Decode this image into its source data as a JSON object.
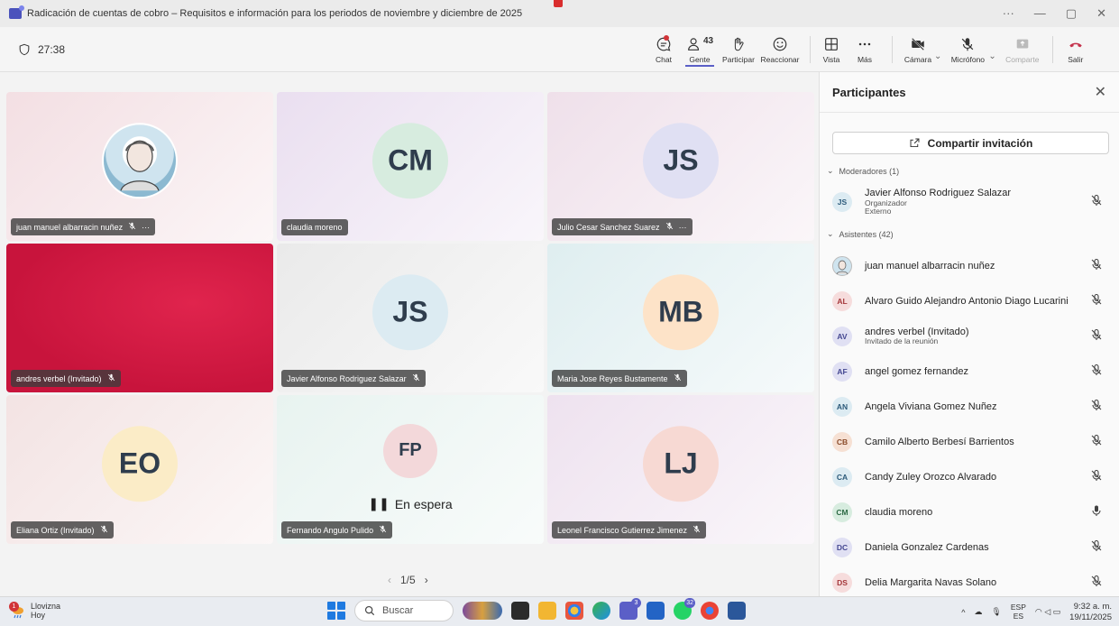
{
  "window": {
    "title": "Radicación de cuentas de cobro – Requisitos e información para los periodos de noviembre y diciembre de 2025",
    "controls": [
      "···",
      "—",
      "▢",
      "✕"
    ]
  },
  "toolbar": {
    "timer": "27:38",
    "people_count": "43",
    "buttons": {
      "chat": "Chat",
      "people": "Gente",
      "raise": "Participar",
      "react": "Reaccionar",
      "view": "Vista",
      "more": "Más",
      "camera": "Cámara",
      "mic": "Micrófono",
      "share": "Comparte",
      "leave": "Salir"
    }
  },
  "tiles": [
    {
      "name": "juan manuel albarracin nuñez",
      "initials": "",
      "has_photo": true,
      "bg": "#f3dfe3",
      "more": "···"
    },
    {
      "name": "claudia moreno",
      "initials": "CM",
      "bg": "#eadff0",
      "avatar_bg": "#d7ecdf"
    },
    {
      "name": "Julio Cesar Sanchez Suarez",
      "initials": "JS",
      "bg": "#efe0ea",
      "avatar_bg": "#e0e0f3",
      "more": "···"
    },
    {
      "name": "andres verbel (Invitado)",
      "initials": "",
      "bg": "#c8143c"
    },
    {
      "name": "Javier Alfonso Rodriguez Salazar",
      "initials": "JS",
      "bg": "#eaeaea",
      "avatar_bg": "#dcebf2"
    },
    {
      "name": "Maria Jose Reyes Bustamente",
      "initials": "MB",
      "bg": "#dfeef0",
      "avatar_bg": "#fde3c8"
    },
    {
      "name": "Eliana Ortiz (Invitado)",
      "initials": "EO",
      "bg": "#f3e3e3",
      "avatar_bg": "#fbecc7"
    },
    {
      "name": "Fernando Angulo Pulido",
      "initials": "FP",
      "bg": "#e8f3f0",
      "avatar_bg": "#f3d8da",
      "status": "En espera"
    },
    {
      "name": "Leonel Francisco Gutierrez Jimenez",
      "initials": "LJ",
      "bg": "#eee2ef",
      "avatar_bg": "#f7d9d3"
    }
  ],
  "pager": {
    "prev": "‹",
    "label": "1/5",
    "next": "›"
  },
  "panel": {
    "title": "Participantes",
    "close": "✕",
    "invite": "Compartir invitación",
    "moderators_header": "Moderadores (1)",
    "attendees_header": "Asistentes (42)",
    "moderators": [
      {
        "initials": "JS",
        "name": "Javier Alfonso Rodriguez Salazar",
        "sub": "Organizador",
        "sub2": "Externo",
        "bg": "#dcebf2",
        "fg": "#2c5a7a",
        "mic": "muted"
      }
    ],
    "attendees": [
      {
        "initials": "",
        "photo": true,
        "name": "juan manuel albarracin nuñez",
        "mic": "muted"
      },
      {
        "initials": "AL",
        "name": "Alvaro Guido Alejandro Antonio Diago Lucarini",
        "bg": "#f6dcdc",
        "fg": "#a4373a",
        "mic": "muted"
      },
      {
        "initials": "AV",
        "name": "andres verbel (Invitado)",
        "sub": "Invitado de la reunión",
        "bg": "#e0e0f3",
        "fg": "#444791",
        "mic": "muted"
      },
      {
        "initials": "AF",
        "name": "angel gomez fernandez",
        "bg": "#e0e0f3",
        "fg": "#444791",
        "mic": "muted"
      },
      {
        "initials": "AN",
        "name": "Angela Viviana Gomez Nuñez",
        "bg": "#dcebf2",
        "fg": "#2c5a7a",
        "mic": "muted"
      },
      {
        "initials": "CB",
        "name": "Camilo Alberto Berbesí Barrientos",
        "bg": "#f6e0d3",
        "fg": "#8a4b2a",
        "mic": "muted"
      },
      {
        "initials": "CA",
        "name": "Candy Zuley Orozco Alvarado",
        "bg": "#dcebf2",
        "fg": "#2c5a7a",
        "mic": "muted"
      },
      {
        "initials": "CM",
        "name": "claudia moreno",
        "bg": "#d7ecdf",
        "fg": "#2d6a45",
        "mic": "on"
      },
      {
        "initials": "DC",
        "name": "Daniela Gonzalez Cardenas",
        "bg": "#e0e0f3",
        "fg": "#444791",
        "mic": "muted"
      },
      {
        "initials": "DS",
        "name": "Delia Margarita Navas Solano",
        "bg": "#f6dcdc",
        "fg": "#a4373a",
        "mic": "muted"
      }
    ]
  },
  "taskbar": {
    "weather_badge": "1",
    "weather_title": "Llovizna",
    "weather_sub": "Hoy",
    "search_placeholder": "Buscar",
    "teams_badge": "3",
    "whatsapp_badge": "32",
    "lang_top": "ESP",
    "lang_bottom": "ES",
    "time": "9:32 a. m.",
    "date": "19/11/2025"
  },
  "colors": {
    "accent": "#5b5fc7",
    "leave": "#c4314b",
    "muted_icon": "#424242"
  }
}
